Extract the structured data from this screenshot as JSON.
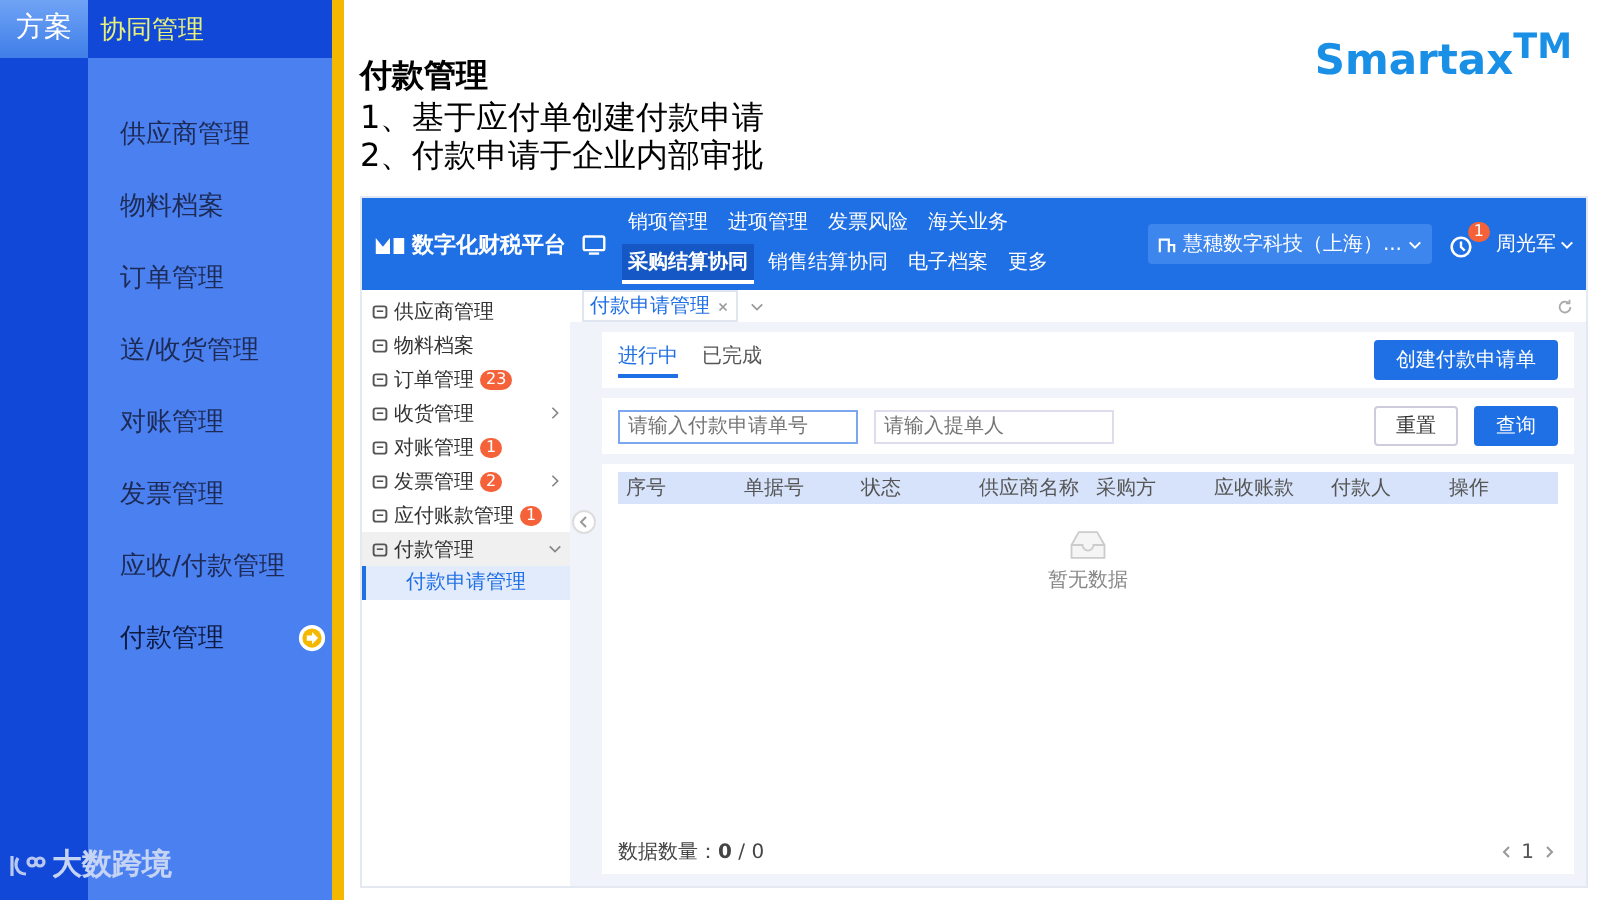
{
  "slide_nav": {
    "section_tab": "方案",
    "section_title": "协同管理",
    "footer_brand": "大数跨境",
    "items": [
      {
        "label": "供应商管理",
        "selected": false
      },
      {
        "label": "物料档案",
        "selected": false
      },
      {
        "label": "订单管理",
        "selected": false
      },
      {
        "label": "送/收货管理",
        "selected": false
      },
      {
        "label": "对账管理",
        "selected": false
      },
      {
        "label": "发票管理",
        "selected": false
      },
      {
        "label": "应收/付款管理",
        "selected": false
      },
      {
        "label": "付款管理",
        "selected": true
      }
    ]
  },
  "brand_logo": "Smartax$^{TM}$",
  "heading": "付款管理",
  "points": [
    "1、基于应付单创建付款申请",
    "2、付款申请于企业内部审批"
  ],
  "app": {
    "platform": "数字化财税平台",
    "nav": [
      {
        "label": "销项管理",
        "selected": false
      },
      {
        "label": "进项管理",
        "selected": false
      },
      {
        "label": "发票风险",
        "selected": false
      },
      {
        "label": "海关业务",
        "selected": false
      },
      {
        "label": "采购结算协同",
        "selected": true
      },
      {
        "label": "销售结算协同",
        "selected": false
      },
      {
        "label": "电子档案",
        "selected": false
      },
      {
        "label": "更多",
        "selected": false
      }
    ],
    "company": "慧穗数字科技（上海）...",
    "notification_count": "1",
    "user": "周光军",
    "sidebar": [
      {
        "label": "供应商管理",
        "has_submenu": false,
        "expanded": false
      },
      {
        "label": "物料档案",
        "has_submenu": false,
        "expanded": false
      },
      {
        "label": "订单管理",
        "badge": "23",
        "has_submenu": false,
        "expanded": false
      },
      {
        "label": "收货管理",
        "has_submenu": true,
        "expanded": false
      },
      {
        "label": "对账管理",
        "badge": "1",
        "has_submenu": false,
        "expanded": false
      },
      {
        "label": "发票管理",
        "badge": "2",
        "has_submenu": true,
        "expanded": false
      },
      {
        "label": "应付账款管理",
        "badge": "1",
        "has_submenu": false,
        "expanded": false
      },
      {
        "label": "付款管理",
        "has_submenu": true,
        "expanded": true,
        "children": [
          {
            "label": "付款申请管理",
            "selected": true
          }
        ]
      }
    ],
    "tab": "付款申请管理",
    "status_tabs": [
      {
        "label": "进行中",
        "selected": true
      },
      {
        "label": "已完成",
        "selected": false
      }
    ],
    "create_button": "创建付款申请单",
    "filters": [
      {
        "placeholder": "请输入付款申请单号"
      },
      {
        "placeholder": "请输入提单人"
      }
    ],
    "reset_button": "重置",
    "search_button": "查询",
    "columns": [
      "序号",
      "单据号",
      "状态",
      "供应商名称",
      "采购方",
      "应收账款",
      "付款人",
      "操作"
    ],
    "empty_text": "暂无数据",
    "total": "数据数量：**0** / 0",
    "page": "1"
  }
}
